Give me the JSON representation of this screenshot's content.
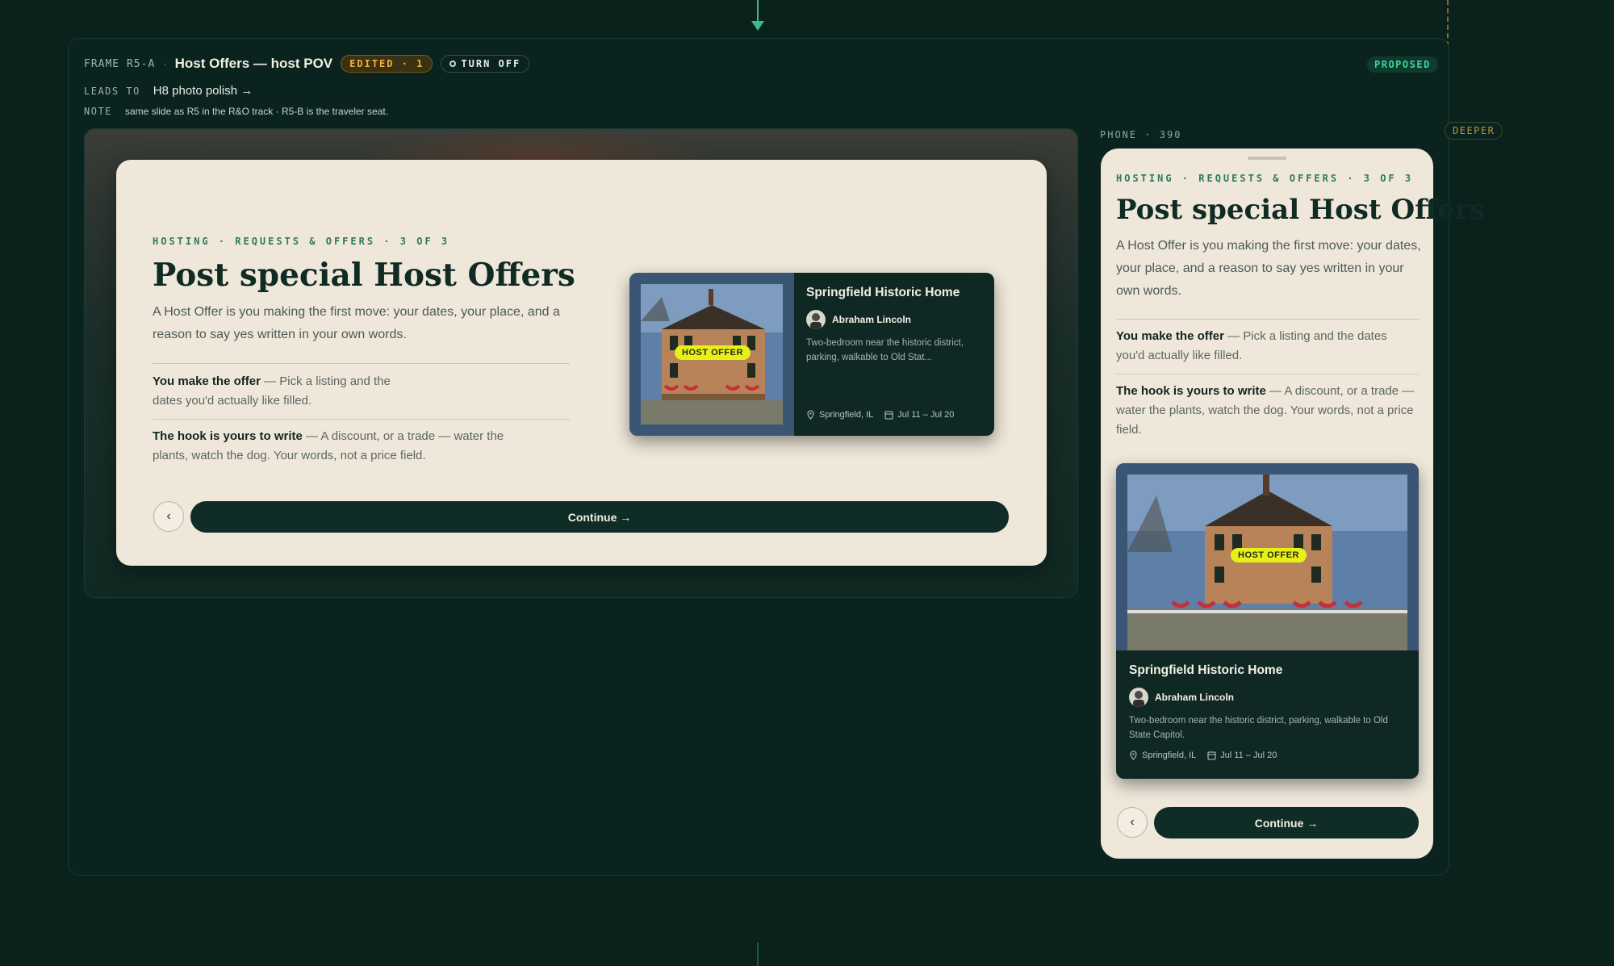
{
  "frame": {
    "id": "FRAME R5-A",
    "separator": "·",
    "title": "Host Offers — host POV",
    "edited_badge": "EDITED · 1",
    "turn_off_label": "TURN OFF",
    "status": "PROPOSED",
    "deeper_label": "DEEPER",
    "leads_to_label": "LEADS TO",
    "leads_to_link": "H8 photo polish →",
    "note_label": "NOTE",
    "note_text": "same slide as R5 in the R&O track · R5-B is the traveler seat."
  },
  "slide": {
    "eyebrow": "HOSTING · REQUESTS & OFFERS · 3 OF 3",
    "title": "Post special Host Offers",
    "lede": "A Host Offer is you making the first move: your dates, your place, and a reason to say yes written in your own words.",
    "points": [
      {
        "bold": "You make the offer",
        "text": " — Pick a listing and the dates you'd actually like filled."
      },
      {
        "bold": "The hook is yours to write",
        "text": " — A discount, or a trade — water the plants, watch the dog. Your words, not a price field."
      }
    ],
    "back_label": "‹",
    "continue_label": "Continue →"
  },
  "listing": {
    "badge": "HOST OFFER",
    "title": "Springfield Historic Home",
    "host_name": "Abraham Lincoln",
    "description": "Two-bedroom near the historic district, parking, walkable to Old State Capitol.",
    "description_short": "Two-bedroom near the historic district, parking, walkable to Old Stat...",
    "location": "Springfield, IL",
    "dates": "Jul 11 – Jul 20"
  },
  "phone": {
    "label": "PHONE · 390"
  },
  "icons": [
    "arrow-down-icon",
    "circle-icon",
    "pin-icon",
    "calendar-icon",
    "chevron-left-icon",
    "avatar-icon"
  ],
  "colors": {
    "background": "#0a211c",
    "card": "#efe8da",
    "accent_green": "#2e7a5a",
    "button": "#0f2d26",
    "host_offer_badge": "#e8f01a",
    "edited_badge": "#f3b13b",
    "proposed_badge": "#3fd49a"
  }
}
